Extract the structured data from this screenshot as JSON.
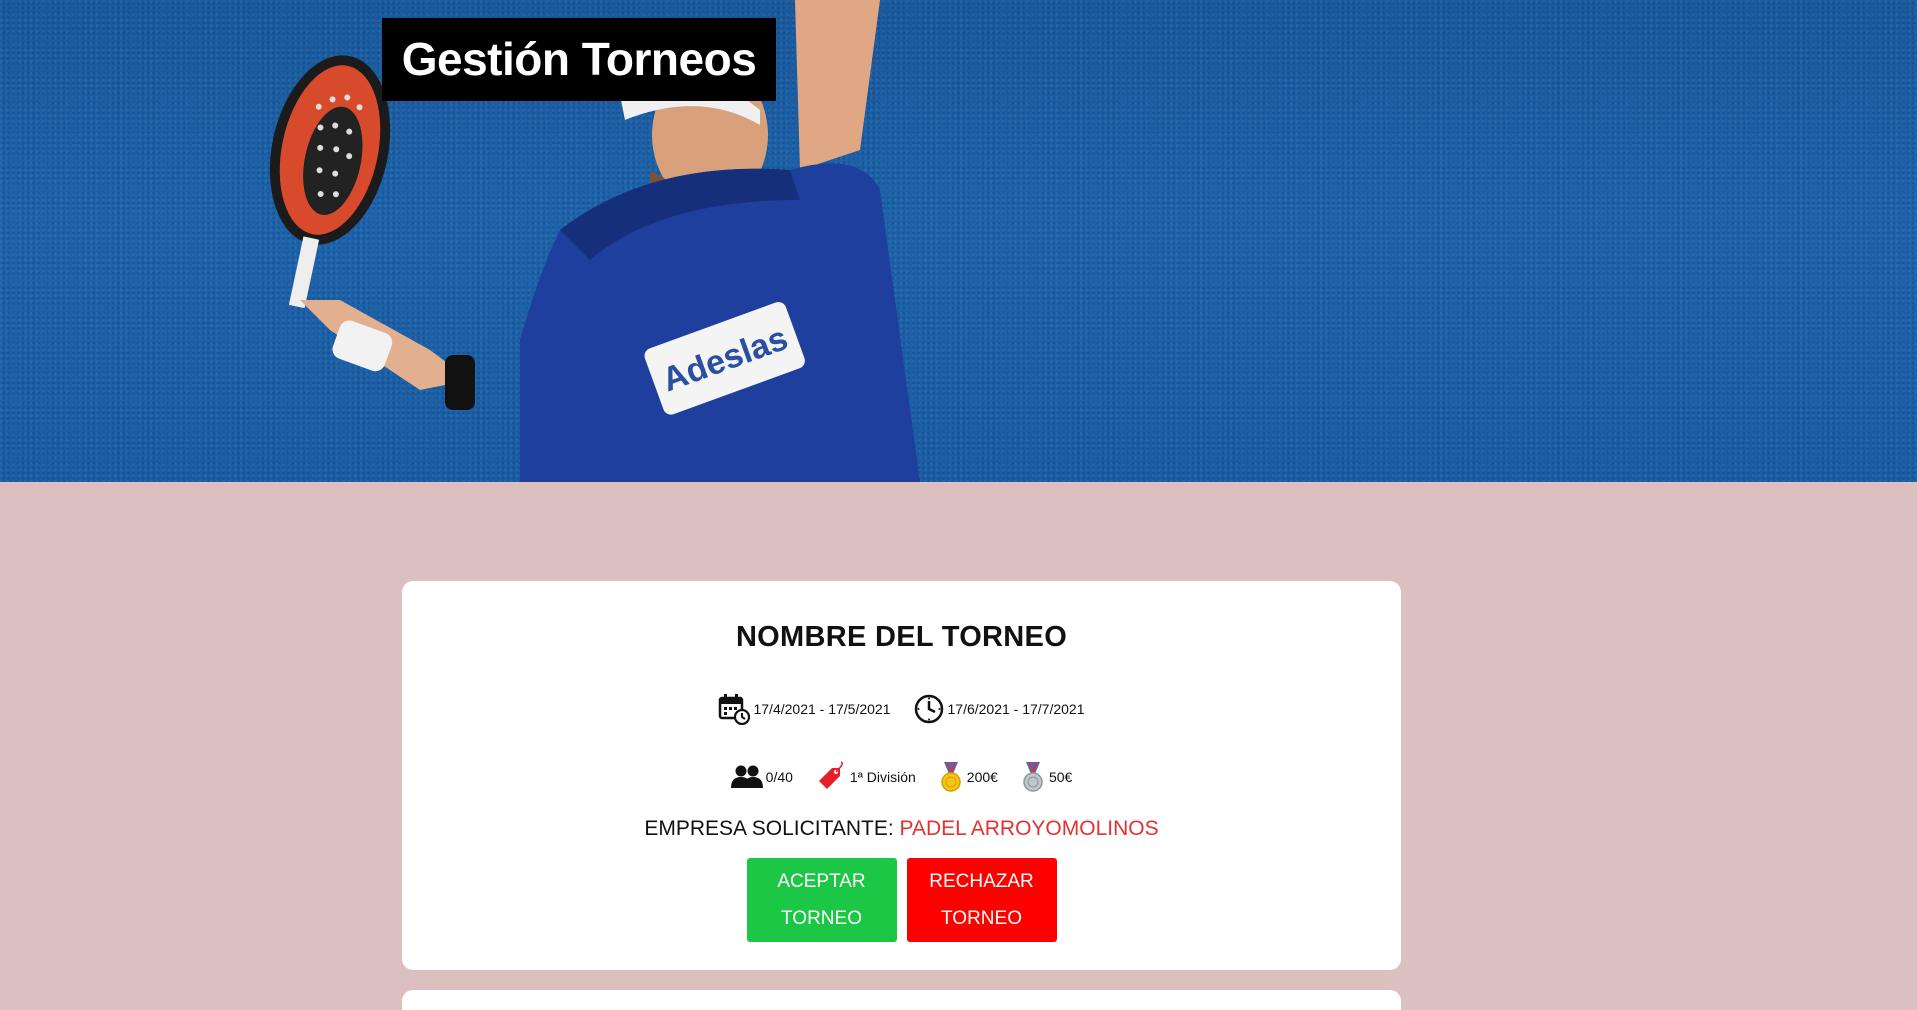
{
  "header": {
    "title": "Gestión Torneos"
  },
  "tournament": {
    "name": "NOMBRE DEL TORNEO",
    "registration_dates": "17/4/2021 - 17/5/2021",
    "play_dates": "17/6/2021 - 17/7/2021",
    "players": "0/40",
    "division": "1ª División",
    "first_prize": "200€",
    "second_prize": "50€",
    "company_label": "EMPRESA SOLICITANTE:",
    "company_name": "PADEL ARROYOMOLINOS"
  },
  "actions": {
    "accept_line1": "ACEPTAR",
    "accept_line2": "TORNEO",
    "reject_line1": "RECHAZAR",
    "reject_line2": "TORNEO"
  },
  "colors": {
    "page_background": "#dcbfbf",
    "accept": "#1bc744",
    "reject": "#ff0000",
    "company_name": "#e23232"
  },
  "icons": {
    "registration": "calendar-clock-icon",
    "play": "clock-icon",
    "players": "users-icon",
    "division": "tag-icon",
    "first_prize": "gold-medal-icon",
    "second_prize": "silver-medal-icon"
  }
}
